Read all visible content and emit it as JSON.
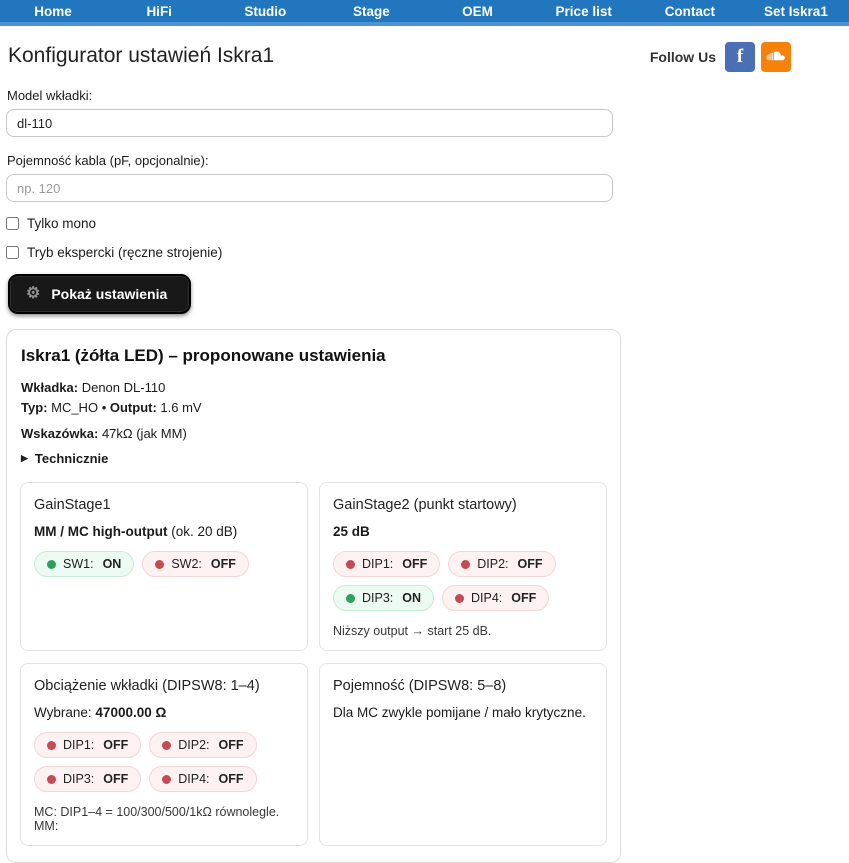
{
  "nav": {
    "items": [
      "Home",
      "HiFi",
      "Studio",
      "Stage",
      "OEM",
      "Price list",
      "Contact",
      "Set Iskra1"
    ]
  },
  "header": {
    "title": "Konfigurator ustawień Iskra1",
    "follow_us": "Follow Us",
    "facebook_glyph": "f"
  },
  "form": {
    "model_label": "Model wkładki:",
    "model_value": "dl-110",
    "capacitance_label": "Pojemność kabla (pF, opcjonalnie):",
    "capacitance_placeholder": "np. 120",
    "mono_checkbox_label": "Tylko mono",
    "expert_checkbox_label": "Tryb ekspercki (ręczne strojenie)",
    "submit_label": "Pokaż ustawienia",
    "gear_icon": "⚙"
  },
  "results": {
    "heading": "Iskra1 (żółta LED) – proponowane ustawienia",
    "cartridge_label": "Wkładka:",
    "cartridge_value": "Denon DL-110",
    "type_label": "Typ:",
    "type_value": "MC_HO",
    "bullet": "•",
    "output_label": "Output:",
    "output_value": "1.6 mV",
    "hint_label": "Wskazówka:",
    "hint_value": "47kΩ (jak MM)",
    "details_marker": "▶",
    "details_toggle": "Technicznie",
    "cards": [
      {
        "title": "GainStage1",
        "subtitle_bold": "MM / MC high-output",
        "subtitle_rest": "(ok. 20 dB)",
        "badges": [
          {
            "label": "SW1:",
            "value": "ON"
          },
          {
            "label": "SW2:",
            "value": "OFF"
          }
        ]
      },
      {
        "title": "GainStage2 (punkt startowy)",
        "subtitle_bold": "25 dB",
        "badges": [
          {
            "label": "DIP1:",
            "value": "OFF"
          },
          {
            "label": "DIP2:",
            "value": "OFF"
          },
          {
            "label": "DIP3:",
            "value": "ON"
          },
          {
            "label": "DIP4:",
            "value": "OFF"
          }
        ],
        "note": "Niższy output → start 25 dB."
      },
      {
        "title": "Obciążenie wkładki (DIPSW8: 1–4)",
        "subtitle_prefix": "Wybrane:",
        "subtitle_bold": "47000.00 Ω",
        "badges": [
          {
            "label": "DIP1:",
            "value": "OFF"
          },
          {
            "label": "DIP2:",
            "value": "OFF"
          },
          {
            "label": "DIP3:",
            "value": "OFF"
          },
          {
            "label": "DIP4:",
            "value": "OFF"
          }
        ],
        "note": "MC: DIP1–4 = 100/300/500/1kΩ równolegle. MM:"
      },
      {
        "title": "Pojemność (DIPSW8: 5–8)",
        "note": "Dla MC zwykle pomijane / mało krytyczne."
      }
    ]
  },
  "colors": {
    "nav_blue": "#2176bd",
    "nav_strip": "#4e93cf",
    "facebook_blue": "#4a6fb5",
    "soundcloud_orange": "#f6820c",
    "button_black": "#181818",
    "badge_on_dot": "#2da05e",
    "badge_off_dot": "#c64a51",
    "badge_on_bg": "#ecfaf1",
    "badge_off_bg": "#fdf1f1"
  }
}
